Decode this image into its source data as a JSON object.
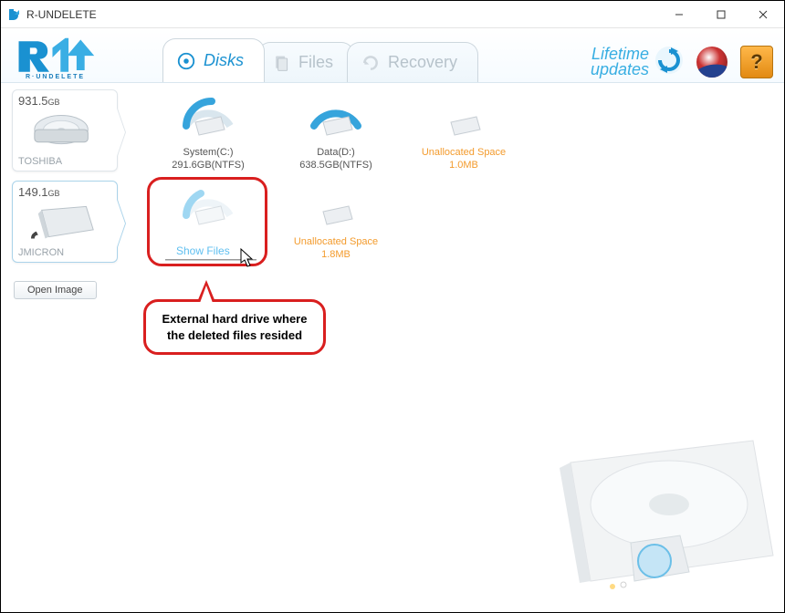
{
  "window": {
    "title": "R-UNDELETE"
  },
  "logo": {
    "brand": "R·UNDELETE"
  },
  "tabs": {
    "disks": "Disks",
    "files": "Files",
    "recovery": "Recovery"
  },
  "header": {
    "updates_line1": "Lifetime",
    "updates_line2": "updates",
    "help": "?"
  },
  "devices": [
    {
      "size_value": "931.5",
      "size_unit": "GB",
      "name": "TOSHIBA"
    },
    {
      "size_value": "149.1",
      "size_unit": "GB",
      "name": "JMICRON"
    }
  ],
  "open_image": "Open Image",
  "row1": [
    {
      "label_line1": "System(C:)",
      "label_line2": "291.6GB(NTFS)",
      "color": "default"
    },
    {
      "label_line1": "Data(D:)",
      "label_line2": "638.5GB(NTFS)",
      "color": "default"
    },
    {
      "label_line1": "Unallocated Space",
      "label_line2": "1.0MB",
      "color": "orange"
    }
  ],
  "row2": [
    {
      "label_line1": "",
      "label_line2": "",
      "color": "default"
    },
    {
      "label_line1": "Unallocated Space",
      "label_line2": "1.8MB",
      "color": "orange"
    }
  ],
  "show_files": "Show Files",
  "callout": "External hard drive where the deleted files resided"
}
